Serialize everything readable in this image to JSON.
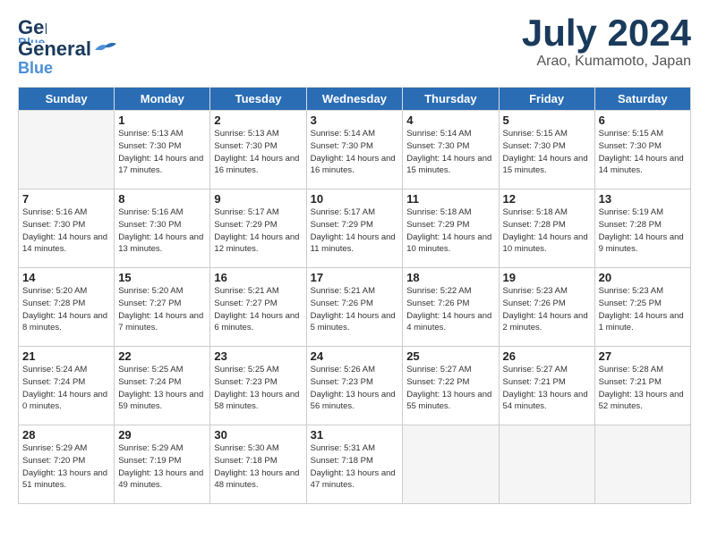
{
  "header": {
    "logo_line1": "General",
    "logo_line2": "Blue",
    "month": "July 2024",
    "location": "Arao, Kumamoto, Japan"
  },
  "weekdays": [
    "Sunday",
    "Monday",
    "Tuesday",
    "Wednesday",
    "Thursday",
    "Friday",
    "Saturday"
  ],
  "weeks": [
    [
      {
        "day": "",
        "info": ""
      },
      {
        "day": "1",
        "info": "Sunrise: 5:13 AM\nSunset: 7:30 PM\nDaylight: 14 hours\nand 17 minutes."
      },
      {
        "day": "2",
        "info": "Sunrise: 5:13 AM\nSunset: 7:30 PM\nDaylight: 14 hours\nand 16 minutes."
      },
      {
        "day": "3",
        "info": "Sunrise: 5:14 AM\nSunset: 7:30 PM\nDaylight: 14 hours\nand 16 minutes."
      },
      {
        "day": "4",
        "info": "Sunrise: 5:14 AM\nSunset: 7:30 PM\nDaylight: 14 hours\nand 15 minutes."
      },
      {
        "day": "5",
        "info": "Sunrise: 5:15 AM\nSunset: 7:30 PM\nDaylight: 14 hours\nand 15 minutes."
      },
      {
        "day": "6",
        "info": "Sunrise: 5:15 AM\nSunset: 7:30 PM\nDaylight: 14 hours\nand 14 minutes."
      }
    ],
    [
      {
        "day": "7",
        "info": "Sunrise: 5:16 AM\nSunset: 7:30 PM\nDaylight: 14 hours\nand 14 minutes."
      },
      {
        "day": "8",
        "info": "Sunrise: 5:16 AM\nSunset: 7:30 PM\nDaylight: 14 hours\nand 13 minutes."
      },
      {
        "day": "9",
        "info": "Sunrise: 5:17 AM\nSunset: 7:29 PM\nDaylight: 14 hours\nand 12 minutes."
      },
      {
        "day": "10",
        "info": "Sunrise: 5:17 AM\nSunset: 7:29 PM\nDaylight: 14 hours\nand 11 minutes."
      },
      {
        "day": "11",
        "info": "Sunrise: 5:18 AM\nSunset: 7:29 PM\nDaylight: 14 hours\nand 10 minutes."
      },
      {
        "day": "12",
        "info": "Sunrise: 5:18 AM\nSunset: 7:28 PM\nDaylight: 14 hours\nand 10 minutes."
      },
      {
        "day": "13",
        "info": "Sunrise: 5:19 AM\nSunset: 7:28 PM\nDaylight: 14 hours\nand 9 minutes."
      }
    ],
    [
      {
        "day": "14",
        "info": "Sunrise: 5:20 AM\nSunset: 7:28 PM\nDaylight: 14 hours\nand 8 minutes."
      },
      {
        "day": "15",
        "info": "Sunrise: 5:20 AM\nSunset: 7:27 PM\nDaylight: 14 hours\nand 7 minutes."
      },
      {
        "day": "16",
        "info": "Sunrise: 5:21 AM\nSunset: 7:27 PM\nDaylight: 14 hours\nand 6 minutes."
      },
      {
        "day": "17",
        "info": "Sunrise: 5:21 AM\nSunset: 7:26 PM\nDaylight: 14 hours\nand 5 minutes."
      },
      {
        "day": "18",
        "info": "Sunrise: 5:22 AM\nSunset: 7:26 PM\nDaylight: 14 hours\nand 4 minutes."
      },
      {
        "day": "19",
        "info": "Sunrise: 5:23 AM\nSunset: 7:26 PM\nDaylight: 14 hours\nand 2 minutes."
      },
      {
        "day": "20",
        "info": "Sunrise: 5:23 AM\nSunset: 7:25 PM\nDaylight: 14 hours\nand 1 minute."
      }
    ],
    [
      {
        "day": "21",
        "info": "Sunrise: 5:24 AM\nSunset: 7:24 PM\nDaylight: 14 hours\nand 0 minutes."
      },
      {
        "day": "22",
        "info": "Sunrise: 5:25 AM\nSunset: 7:24 PM\nDaylight: 13 hours\nand 59 minutes."
      },
      {
        "day": "23",
        "info": "Sunrise: 5:25 AM\nSunset: 7:23 PM\nDaylight: 13 hours\nand 58 minutes."
      },
      {
        "day": "24",
        "info": "Sunrise: 5:26 AM\nSunset: 7:23 PM\nDaylight: 13 hours\nand 56 minutes."
      },
      {
        "day": "25",
        "info": "Sunrise: 5:27 AM\nSunset: 7:22 PM\nDaylight: 13 hours\nand 55 minutes."
      },
      {
        "day": "26",
        "info": "Sunrise: 5:27 AM\nSunset: 7:21 PM\nDaylight: 13 hours\nand 54 minutes."
      },
      {
        "day": "27",
        "info": "Sunrise: 5:28 AM\nSunset: 7:21 PM\nDaylight: 13 hours\nand 52 minutes."
      }
    ],
    [
      {
        "day": "28",
        "info": "Sunrise: 5:29 AM\nSunset: 7:20 PM\nDaylight: 13 hours\nand 51 minutes."
      },
      {
        "day": "29",
        "info": "Sunrise: 5:29 AM\nSunset: 7:19 PM\nDaylight: 13 hours\nand 49 minutes."
      },
      {
        "day": "30",
        "info": "Sunrise: 5:30 AM\nSunset: 7:18 PM\nDaylight: 13 hours\nand 48 minutes."
      },
      {
        "day": "31",
        "info": "Sunrise: 5:31 AM\nSunset: 7:18 PM\nDaylight: 13 hours\nand 47 minutes."
      },
      {
        "day": "",
        "info": ""
      },
      {
        "day": "",
        "info": ""
      },
      {
        "day": "",
        "info": ""
      }
    ]
  ]
}
